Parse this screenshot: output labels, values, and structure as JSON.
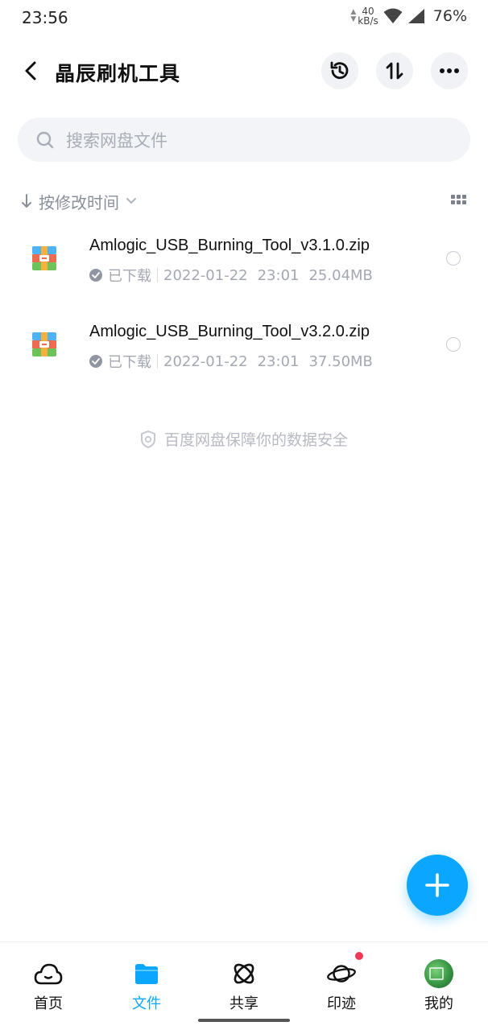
{
  "status_bar": {
    "time": "23:56",
    "net_speed_value": "40",
    "net_speed_unit": "kB/s",
    "battery": "76%"
  },
  "header": {
    "title": "晶辰刷机工具",
    "back_icon": "chevron-left-icon",
    "buttons": [
      "history-icon",
      "transfer-icon",
      "more-icon"
    ]
  },
  "search": {
    "placeholder": "搜索网盘文件"
  },
  "sort": {
    "label": "按修改时间",
    "view_toggle_icon": "grid-view-icon"
  },
  "files": [
    {
      "name": "Amlogic_USB_Burning_Tool_v3.1.0.zip",
      "status": "已下载",
      "date": "2022-01-22",
      "time": "23:01",
      "size": "25.04MB",
      "icon": "zip-archive-icon"
    },
    {
      "name": "Amlogic_USB_Burning_Tool_v3.2.0.zip",
      "status": "已下载",
      "date": "2022-01-22",
      "time": "23:01",
      "size": "37.50MB",
      "icon": "zip-archive-icon"
    }
  ],
  "safety_note": "百度网盘保障你的数据安全",
  "nav": {
    "items": [
      {
        "label": "首页",
        "icon": "cloud-home-icon"
      },
      {
        "label": "文件",
        "icon": "folder-icon",
        "active": true
      },
      {
        "label": "共享",
        "icon": "share-atom-icon"
      },
      {
        "label": "印迹",
        "icon": "planet-icon",
        "badge": true
      },
      {
        "label": "我的",
        "icon": "avatar"
      }
    ]
  },
  "colors": {
    "accent": "#0aa6ff",
    "badge": "#f2385a",
    "muted_text": "#a4a8b2"
  }
}
